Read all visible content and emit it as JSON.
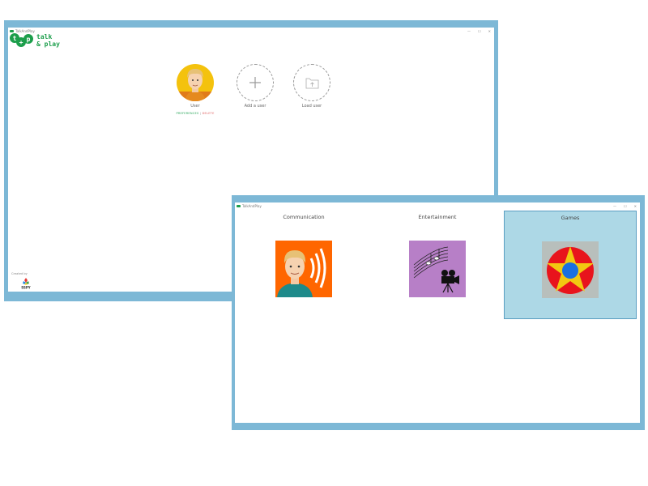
{
  "login_window": {
    "title": "TalkAndPlay",
    "controls": [
      "—",
      "☐",
      "✕"
    ],
    "logo": {
      "text": "talk\n& play",
      "letters": [
        "t",
        "+",
        "p"
      ]
    },
    "users": [
      {
        "name": "User",
        "actions": {
          "preferences": "PREFERENCES",
          "separator": "|",
          "delete": "DELETE"
        }
      }
    ],
    "add_user_label": "Add a user",
    "load_user_label": "Load user",
    "created_by": "Created by",
    "ssp_label": "SSPY",
    "corner_text": "Built"
  },
  "categories_window": {
    "title": "TalkAndPlay",
    "controls": [
      "—",
      "☐",
      "✕"
    ],
    "categories": [
      {
        "label": "Communication",
        "tile_color": "#ff6600",
        "icon": "speaking-person-icon",
        "selected": false
      },
      {
        "label": "Entertainment",
        "tile_color": "#b77fc7",
        "icon": "music-film-icon",
        "selected": false
      },
      {
        "label": "Games",
        "tile_color": "#b8bfbc",
        "icon": "star-icon",
        "selected": true
      }
    ]
  },
  "colors": {
    "window_frame": "#7db8d6",
    "brand_green": "#1c9e4b",
    "avatar_yellow": "#f4c20d",
    "selected_bg": "#add8e6"
  }
}
